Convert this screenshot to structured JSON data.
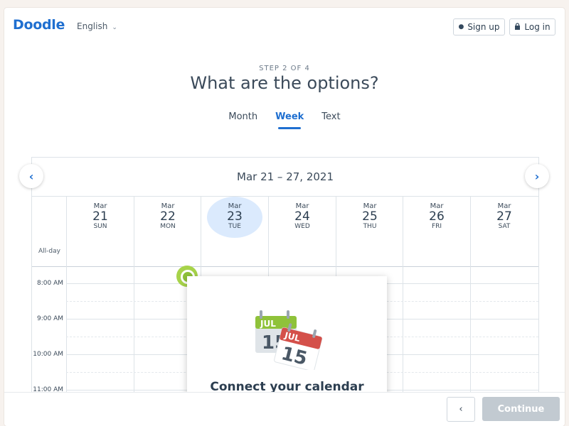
{
  "header": {
    "logo": "Doodle",
    "language": "English",
    "signup_label": "Sign up",
    "login_label": "Log in"
  },
  "wizard": {
    "step": "STEP 2 OF 4",
    "title": "What are the options?",
    "tabs": [
      {
        "label": "Month",
        "active": false
      },
      {
        "label": "Week",
        "active": true
      },
      {
        "label": "Text",
        "active": false
      }
    ]
  },
  "calendar": {
    "range": "Mar 21 – 27, 2021",
    "allday_label": "All-day",
    "days": [
      {
        "month": "Mar",
        "num": "21",
        "dow": "SUN",
        "today": false
      },
      {
        "month": "Mar",
        "num": "22",
        "dow": "MON",
        "today": false
      },
      {
        "month": "Mar",
        "num": "23",
        "dow": "TUE",
        "today": true
      },
      {
        "month": "Mar",
        "num": "24",
        "dow": "WED",
        "today": false
      },
      {
        "month": "Mar",
        "num": "25",
        "dow": "THU",
        "today": false
      },
      {
        "month": "Mar",
        "num": "26",
        "dow": "FRI",
        "today": false
      },
      {
        "month": "Mar",
        "num": "27",
        "dow": "SAT",
        "today": false
      }
    ],
    "times": [
      "8:00 AM",
      "9:00 AM",
      "10:00 AM",
      "11:00 AM"
    ]
  },
  "popup": {
    "icon_month": "JUL",
    "icon_day": "15",
    "title": "Connect your calendar"
  },
  "footer": {
    "back_icon": "chevron-left-icon",
    "continue_label": "Continue"
  },
  "colors": {
    "brand": "#1f6fd0",
    "today_bubble": "#dbeafd",
    "accent_green": "#8fc23a",
    "disabled_button": "#c2cad1"
  }
}
